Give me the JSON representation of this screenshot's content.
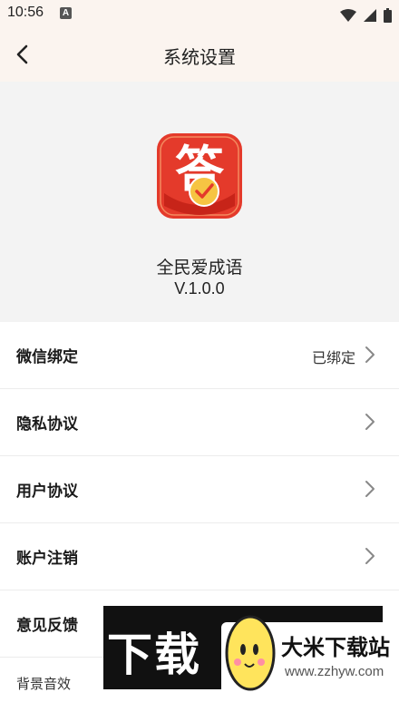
{
  "status_bar": {
    "time": "10:56",
    "notification_badge": "A",
    "icons": [
      "wifi-icon",
      "signal-icon",
      "battery-icon"
    ]
  },
  "header": {
    "title": "系统设置",
    "back_icon": "chevron-left-icon"
  },
  "app": {
    "logo_glyph": "答",
    "name": "全民爱成语",
    "version": "V.1.0.0"
  },
  "settings": {
    "items": [
      {
        "label": "微信绑定",
        "value": "已绑定"
      },
      {
        "label": "隐私协议"
      },
      {
        "label": "用户协议"
      },
      {
        "label": "账户注销"
      },
      {
        "label": "意见反馈"
      },
      {
        "label": "背景音效"
      }
    ]
  },
  "watermark": {
    "dark_text": "下载",
    "brand": "大米下载站",
    "url": "www.zzhyw.com"
  },
  "colors": {
    "topbar_bg": "#fbf4ef",
    "header_bg": "#f3f3f3",
    "logo_red": "#e43a2b",
    "logo_gold": "#f6c443"
  }
}
